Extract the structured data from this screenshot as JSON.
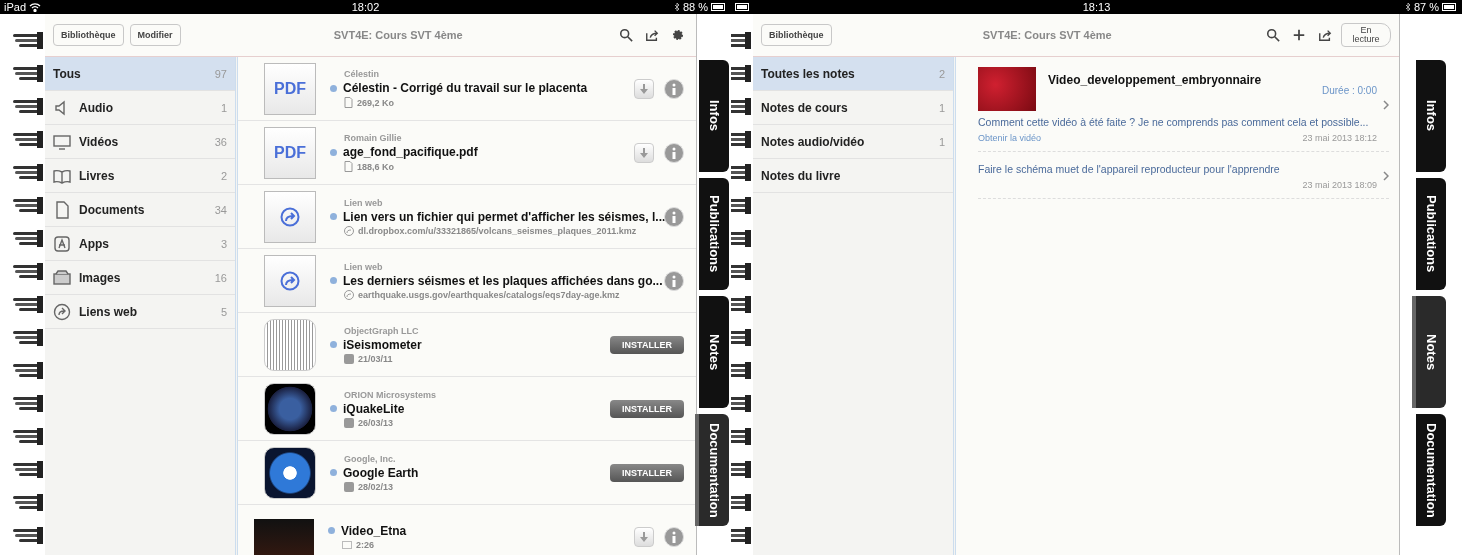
{
  "panes": [
    {
      "status_bar": {
        "device": "iPad",
        "time": "18:02",
        "battery": "88 %"
      },
      "toolbar": {
        "kind": "library",
        "buttons": [
          "Bibliothèque",
          "Modifier"
        ],
        "title": "SVT4E: Cours SVT 4ème"
      },
      "sidebar": [
        {
          "kind": "all",
          "label": "Tous",
          "count": "97",
          "selected": true
        },
        {
          "kind": "audio",
          "label": "Audio",
          "count": "1",
          "selected": false
        },
        {
          "kind": "video",
          "label": "Vidéos",
          "count": "36",
          "selected": false
        },
        {
          "kind": "book",
          "label": "Livres",
          "count": "2",
          "selected": false
        },
        {
          "kind": "document",
          "label": "Documents",
          "count": "34",
          "selected": false
        },
        {
          "kind": "app",
          "label": "Apps",
          "count": "3",
          "selected": false
        },
        {
          "kind": "image",
          "label": "Images",
          "count": "16",
          "selected": false
        },
        {
          "kind": "link",
          "label": "Liens web",
          "count": "5",
          "selected": false
        }
      ],
      "items": [
        {
          "kind": "pdf",
          "thumb_label": "PDF",
          "source": "Célestin",
          "title": "Célestin - Corrigé du travail sur le placenta",
          "meta": "269,2 Ko",
          "unread": true
        },
        {
          "kind": "pdf",
          "thumb_label": "PDF",
          "source": "Romain Gillie",
          "title": "age_fond_pacifique.pdf",
          "meta": "188,6 Ko",
          "unread": true
        },
        {
          "kind": "link",
          "source": "Lien web",
          "title": "Lien vers un fichier qui permet d'afficher les séismes, l...",
          "meta": "dl.dropbox.com/u/33321865/volcans_seismes_plaques_2011.kmz",
          "unread": true
        },
        {
          "kind": "link",
          "source": "Lien web",
          "title": "Les derniers séismes et les plaques affichées dans go...",
          "meta": "earthquake.usgs.gov/earthquakes/catalogs/eqs7day-age.kmz",
          "unread": true
        },
        {
          "kind": "app",
          "source": "ObjectGraph LLC",
          "title": "iSeismometer",
          "meta": "21/03/11",
          "button": "INSTALLER",
          "unread": true
        },
        {
          "kind": "app",
          "source": "ORION Microsystems",
          "title": "iQuakeLite",
          "meta": "26/03/13",
          "button": "INSTALLER",
          "unread": true
        },
        {
          "kind": "app",
          "source": "Google, Inc.",
          "title": "Google Earth",
          "meta": "28/02/13",
          "button": "INSTALLER",
          "unread": true
        },
        {
          "kind": "video",
          "title": "Video_Etna",
          "meta": "2:26",
          "unread": true
        }
      ],
      "side_tabs": [
        {
          "label": "Infos",
          "selected": false
        },
        {
          "label": "Publications",
          "selected": false
        },
        {
          "label": "Notes",
          "selected": false
        },
        {
          "label": "Documentation",
          "selected": true
        }
      ]
    },
    {
      "status_bar": {
        "time": "18:13",
        "battery": "87 %"
      },
      "toolbar": {
        "kind": "notes",
        "buttons": [
          "Bibliothèque"
        ],
        "title": "SVT4E: Cours SVT 4ème",
        "nav_button": "En lecture"
      },
      "sidebar": [
        {
          "kind": "plain",
          "label": "Toutes les notes",
          "count": "2",
          "selected": true
        },
        {
          "kind": "plain",
          "label": "Notes de cours",
          "count": "1",
          "selected": false
        },
        {
          "kind": "plain",
          "label": "Notes audio/vidéo",
          "count": "1",
          "selected": false
        },
        {
          "kind": "plain",
          "label": "Notes du livre",
          "selected": false
        }
      ],
      "notes": [
        {
          "kind": "video",
          "title": "Video_developpement_embryonnaire",
          "duration": "Durée : 0:00",
          "text": "Comment cette vidéo à été faite ? Je ne comprends pas comment cela et possible...",
          "link": "Obtenir la vidéo",
          "date": "23 mai 2013 18:12"
        },
        {
          "kind": "text",
          "text": "Faire le schéma muet de l'appareil reproducteur pour l'apprendre",
          "date": "23 mai 2013 18:09"
        }
      ],
      "side_tabs": [
        {
          "label": "Infos",
          "selected": false
        },
        {
          "label": "Publications",
          "selected": false
        },
        {
          "label": "Notes",
          "selected": true
        },
        {
          "label": "Documentation",
          "selected": false
        }
      ]
    }
  ]
}
